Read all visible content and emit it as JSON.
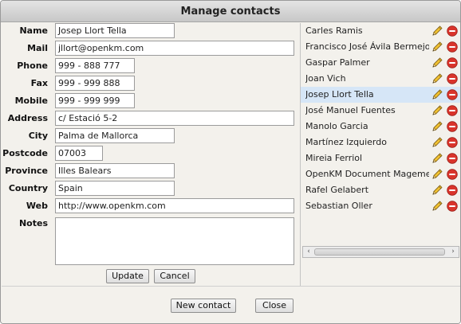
{
  "dialog": {
    "title": "Manage contacts"
  },
  "form": {
    "fields": [
      {
        "key": "name",
        "label": "Name",
        "value": "Josep Llort Tella"
      },
      {
        "key": "mail",
        "label": "Mail",
        "value": "jllort@openkm.com"
      },
      {
        "key": "phone",
        "label": "Phone",
        "value": "999 - 888 777"
      },
      {
        "key": "fax",
        "label": "Fax",
        "value": "999 - 999 888"
      },
      {
        "key": "mobile",
        "label": "Mobile",
        "value": "999 - 999 999"
      },
      {
        "key": "address",
        "label": "Address",
        "value": "c/ Estació 5-2"
      },
      {
        "key": "city",
        "label": "City",
        "value": "Palma de Mallorca"
      },
      {
        "key": "postcode",
        "label": "Postcode",
        "value": "07003"
      },
      {
        "key": "province",
        "label": "Province",
        "value": "Illes Balears"
      },
      {
        "key": "country",
        "label": "Country",
        "value": "Spain"
      },
      {
        "key": "web",
        "label": "Web",
        "value": "http://www.openkm.com"
      }
    ],
    "notes_label": "Notes",
    "notes_value": "",
    "update_label": "Update",
    "cancel_label": "Cancel"
  },
  "contacts": {
    "items": [
      {
        "name": "Carles Ramis",
        "selected": false
      },
      {
        "name": "Francisco José Ávila Bermejo",
        "selected": false
      },
      {
        "name": "Gaspar Palmer",
        "selected": false
      },
      {
        "name": "Joan Vich",
        "selected": false
      },
      {
        "name": "Josep Llort Tella",
        "selected": true
      },
      {
        "name": "José Manuel Fuentes",
        "selected": false
      },
      {
        "name": "Manolo Garcia",
        "selected": false
      },
      {
        "name": "Martínez Izquierdo",
        "selected": false
      },
      {
        "name": "Mireia Ferriol",
        "selected": false
      },
      {
        "name": "OpenKM Document Magement",
        "selected": false
      },
      {
        "name": "Rafel Gelabert",
        "selected": false
      },
      {
        "name": "Sebastian Oller",
        "selected": false
      }
    ],
    "edit_icon": "pencil-icon",
    "delete_icon": "delete-icon"
  },
  "footer": {
    "new_contact_label": "New contact",
    "close_label": "Close"
  },
  "colors": {
    "selected_row": "#d6e6f7",
    "delete_red": "#d9342b",
    "pencil_yellow": "#f1c232"
  }
}
